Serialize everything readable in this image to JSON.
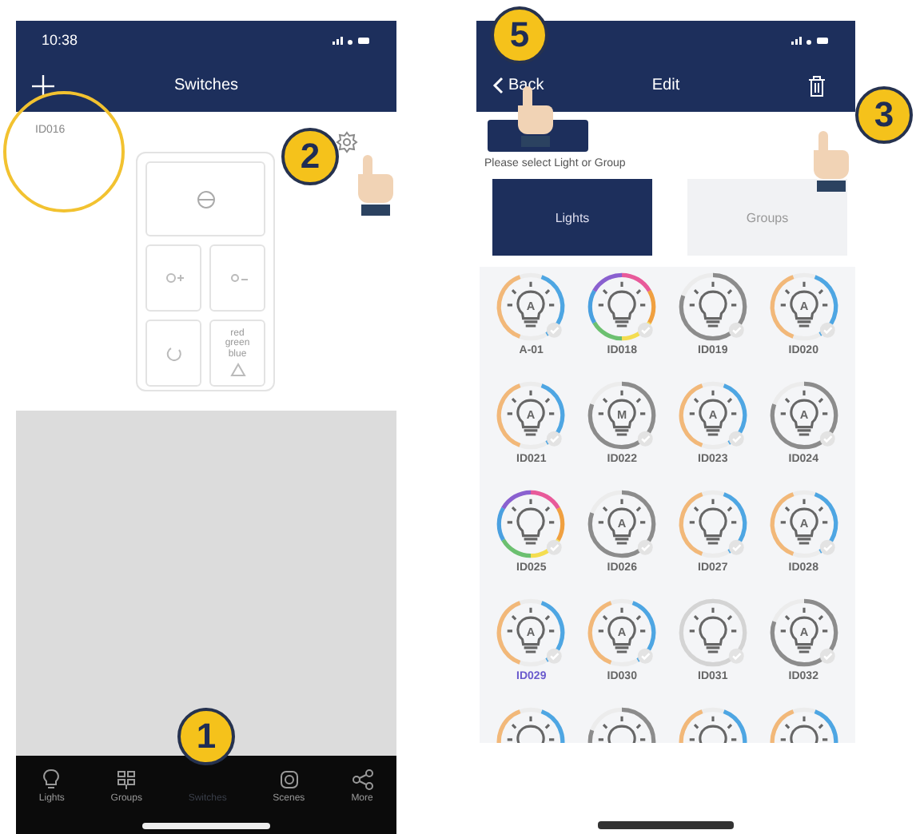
{
  "left_screen": {
    "status_bar": {
      "time": "10:38"
    },
    "title": "Switches",
    "switch": {
      "name": "ID016",
      "buttons": [
        {
          "kind": "power"
        },
        {
          "kind": "brighter"
        },
        {
          "kind": "dimmer"
        },
        {
          "kind": "cycle"
        },
        {
          "kind": "color",
          "label": "red green blue"
        }
      ]
    },
    "tab_bar": [
      {
        "label": "Lights",
        "kind": "bulb",
        "selected": false
      },
      {
        "label": "Groups",
        "kind": "grid",
        "selected": false
      },
      {
        "label": "Switches",
        "kind": "hidden",
        "selected": true
      },
      {
        "label": "Scenes",
        "kind": "scenes",
        "selected": false
      },
      {
        "label": "More",
        "kind": "share",
        "selected": false
      }
    ]
  },
  "right_screen": {
    "back": "Back",
    "title": "Edit",
    "prompt": "Please select Light or Group",
    "tabs": [
      {
        "label": "Lights",
        "selected": true
      },
      {
        "label": "Groups",
        "selected": false
      }
    ],
    "lights": [
      {
        "label": "A-01",
        "kind": "cct",
        "mode": "A",
        "selected": false
      },
      {
        "label": "ID018",
        "kind": "rgb",
        "selected": false
      },
      {
        "label": "ID019",
        "kind": "grey",
        "selected": false
      },
      {
        "label": "ID020",
        "kind": "cct",
        "mode": "A",
        "selected": false
      },
      {
        "label": "ID021",
        "kind": "cct",
        "mode": "A",
        "selected": false
      },
      {
        "label": "ID022",
        "kind": "grey",
        "mode": "M",
        "selected": false
      },
      {
        "label": "ID023",
        "kind": "cct",
        "mode": "A",
        "selected": false
      },
      {
        "label": "ID024",
        "kind": "grey",
        "mode": "A",
        "selected": false
      },
      {
        "label": "ID025",
        "kind": "rgb",
        "selected": false
      },
      {
        "label": "ID026",
        "kind": "grey",
        "mode": "A",
        "selected": false
      },
      {
        "label": "ID027",
        "kind": "cct",
        "selected": false
      },
      {
        "label": "ID028",
        "kind": "cct",
        "mode": "A",
        "selected": false
      },
      {
        "label": "ID029",
        "kind": "cct",
        "mode": "A",
        "selected": true
      },
      {
        "label": "ID030",
        "kind": "cct",
        "mode": "A",
        "selected": false
      },
      {
        "label": "ID031",
        "kind": "light",
        "selected": false
      },
      {
        "label": "ID032",
        "kind": "grey",
        "mode": "A",
        "selected": false
      }
    ],
    "partial_row": [
      {
        "kind": "cct"
      },
      {
        "kind": "grey"
      },
      {
        "kind": "cct"
      },
      {
        "kind": "cct"
      }
    ]
  },
  "steps": [
    {
      "number": "1",
      "kind": "tabbar",
      "hand": false
    },
    {
      "number": "2",
      "kind": "gear",
      "hand": true
    },
    {
      "number": "3",
      "kind": "trash",
      "hand": true
    },
    {
      "number": "5",
      "kind": "back",
      "hand": true
    }
  ]
}
